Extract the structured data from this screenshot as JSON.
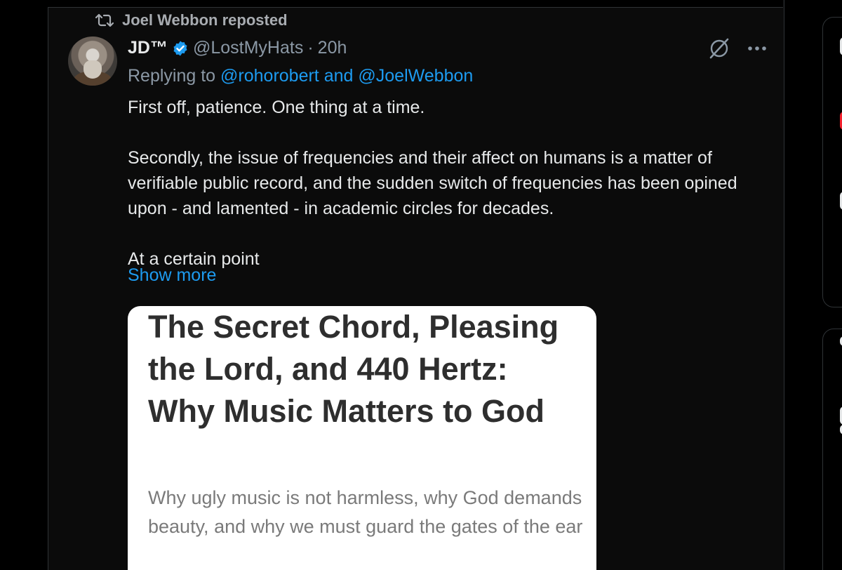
{
  "repost": {
    "label": "Joel Webbon reposted"
  },
  "tweet": {
    "display_name": "JD™",
    "handle": "@LostMyHats",
    "separator": "·",
    "time": "20h",
    "replying_prefix": "Replying to",
    "replying_user_1": "@rohorobert",
    "replying_and": "and",
    "replying_user_2": "@JoelWebbon",
    "paragraphs": [
      "First off, patience. One thing at a time.",
      "Secondly, the issue of frequencies and their affect on humans is a matter of verifiable public record, and the sudden switch of frequencies has been opined upon - and lamented - in academic circles for decades.",
      "At a certain point"
    ],
    "show_more": "Show more"
  },
  "card": {
    "title": "The Secret Chord, Pleasing the Lord, and 440 Hertz: Why Music Matters to God",
    "subtitle": "Why ugly music is not harmless, why God demands beauty, and why we must guard the gates of the ear"
  },
  "icons": {
    "repost": "repost-icon",
    "verified": "verified-badge-icon",
    "grok": "grok-icon",
    "more": "more-options-icon"
  },
  "colors": {
    "background": "#000000",
    "text": "#e7e9ea",
    "muted": "#8b98a5",
    "link": "#1d9bf0",
    "card_bg": "#ffffff"
  }
}
